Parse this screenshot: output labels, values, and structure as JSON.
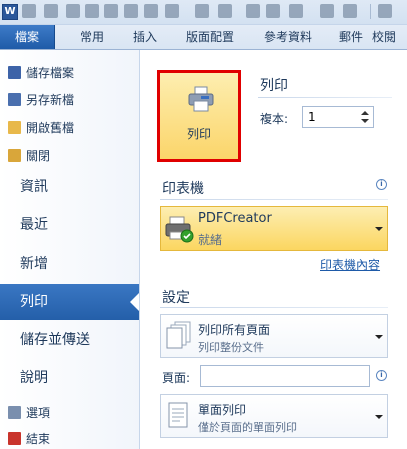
{
  "app": {
    "logo_letter": "W"
  },
  "ribbon_tabs": [
    {
      "label": "檔案"
    },
    {
      "label": "常用"
    },
    {
      "label": "插入"
    },
    {
      "label": "版面配置"
    },
    {
      "label": "參考資料"
    },
    {
      "label": "郵件"
    },
    {
      "label": "校閱"
    }
  ],
  "backstage": {
    "items_small_top": [
      {
        "label": "儲存檔案",
        "icon": "save-icon"
      },
      {
        "label": "另存新檔",
        "icon": "save-as-icon"
      },
      {
        "label": "開啟舊檔",
        "icon": "open-folder-icon"
      },
      {
        "label": "關閉",
        "icon": "close-doc-icon"
      }
    ],
    "items_big": [
      {
        "label": "資訊"
      },
      {
        "label": "最近"
      },
      {
        "label": "新增"
      },
      {
        "label": "列印",
        "active": true
      },
      {
        "label": "儲存並傳送"
      },
      {
        "label": "說明"
      }
    ],
    "items_small_bottom": [
      {
        "label": "選項",
        "icon": "options-icon"
      },
      {
        "label": "結束",
        "icon": "exit-icon"
      }
    ]
  },
  "print": {
    "button_label": "列印",
    "heading": "列印",
    "copies_label": "複本:",
    "copies_value": "1"
  },
  "printer_section": {
    "heading": "印表機",
    "printer_name": "PDFCreator",
    "printer_status": "就緒",
    "properties_link": "印表機內容"
  },
  "settings": {
    "heading": "設定",
    "range_title": "列印所有頁面",
    "range_sub": "列印整份文件",
    "pages_label": "頁面:",
    "pages_value": "",
    "sides_title": "單面列印",
    "sides_sub": "僅於頁面的單面列印"
  },
  "colors": {
    "file_tab": "#2b67b5",
    "highlight": "#fbd56a",
    "selection_border": "#e00000"
  }
}
